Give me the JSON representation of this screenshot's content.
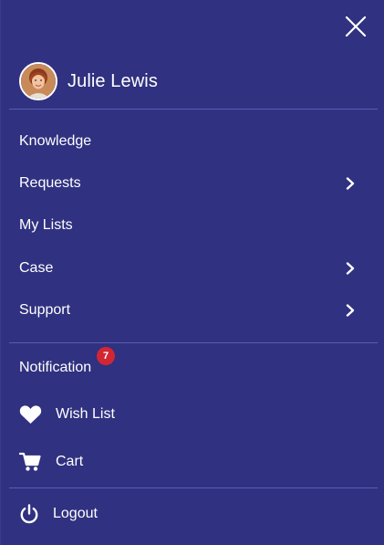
{
  "user": {
    "name": "Julie Lewis"
  },
  "menu": {
    "primary": [
      {
        "label": "Knowledge",
        "has_submenu": false
      },
      {
        "label": "Requests",
        "has_submenu": true
      },
      {
        "label": "My Lists",
        "has_submenu": false
      },
      {
        "label": "Case",
        "has_submenu": true
      },
      {
        "label": "Support",
        "has_submenu": true
      }
    ],
    "notification": {
      "label": "Notification",
      "badge_count": "7"
    },
    "wish_list": {
      "label": "Wish List",
      "icon": "heart-icon"
    },
    "cart": {
      "label": "Cart",
      "icon": "cart-icon"
    },
    "logout": {
      "label": "Logout",
      "icon": "power-icon"
    }
  },
  "colors": {
    "background": "#303180",
    "divider": "#5a5cb8",
    "badge": "#d22633",
    "text": "#ffffff"
  }
}
